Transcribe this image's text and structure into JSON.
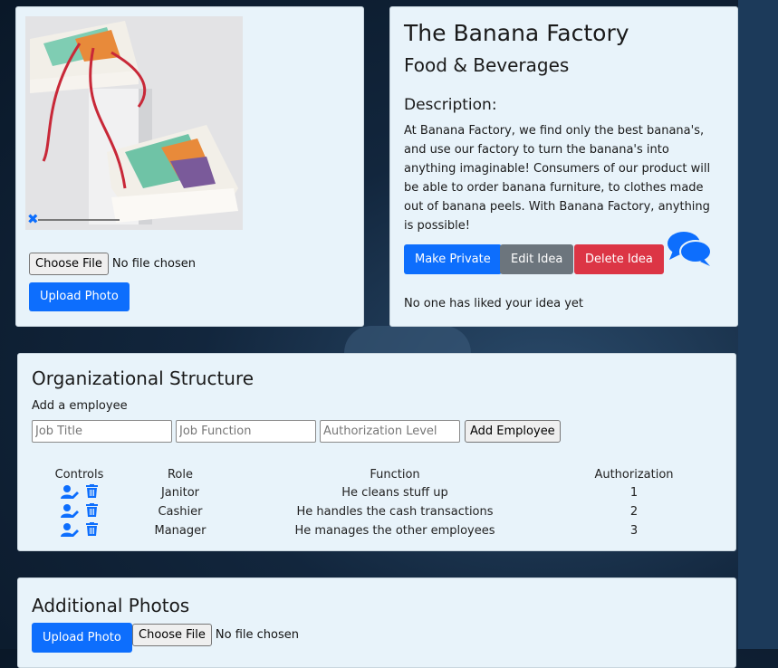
{
  "idea": {
    "title": "The Banana Factory",
    "category": "Food & Beverages",
    "description_heading": "Description:",
    "description": "At Banana Factory, we find only the best banana's, and use our factory to turn the banana's into anything imaginable! Consumers of our product will be able to order banana furniture, to clothes made out of banana peels. With Banana Factory, anything is possible!",
    "buttons": {
      "make_private": "Make Private",
      "edit": "Edit Idea",
      "delete": "Delete Idea"
    },
    "likes_text": "No one has liked your idea yet"
  },
  "photo": {
    "choose_file": "Choose File",
    "no_file": "No file chosen",
    "upload": "Upload Photo",
    "remove_icon": "close-icon"
  },
  "org": {
    "heading": "Organizational Structure",
    "add_label": "Add a employee",
    "placeholders": {
      "job_title": "Job Title",
      "job_function": "Job Function",
      "auth_level": "Authorization Level"
    },
    "add_button": "Add Employee",
    "columns": [
      "Controls",
      "Role",
      "Function",
      "Authorization"
    ],
    "rows": [
      {
        "role": "Janitor",
        "function": "He cleans stuff up",
        "auth": "1"
      },
      {
        "role": "Cashier",
        "function": "He handles the cash transactions",
        "auth": "2"
      },
      {
        "role": "Manager",
        "function": "He manages the other employees",
        "auth": "3"
      }
    ],
    "icons": {
      "edit": "user-edit-icon",
      "delete": "trash-icon"
    }
  },
  "additional": {
    "heading": "Additional Photos",
    "upload": "Upload Photo",
    "choose_file": "Choose File",
    "no_file": "No file chosen"
  },
  "colors": {
    "primary": "#0d6efd",
    "secondary": "#6c757d",
    "danger": "#dc3545",
    "card_bg": "#e8f3fa"
  }
}
